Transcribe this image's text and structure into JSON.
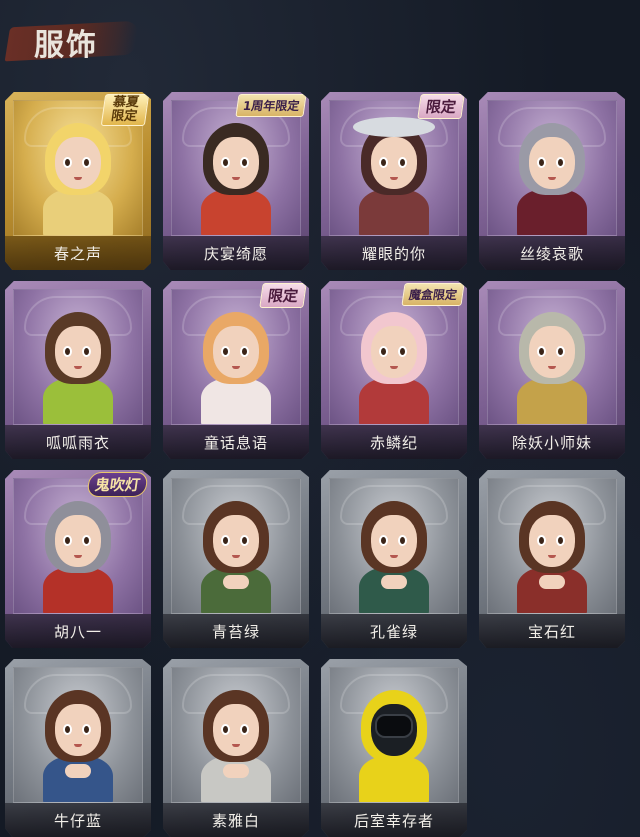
{
  "header": {
    "title": "服饰"
  },
  "costumes": [
    {
      "name": "春之声",
      "style": "gold",
      "badge": "慕夏限定",
      "badge_style": "gold-stamp",
      "hair": "#f2d46a",
      "outfit": "#e9cf7a"
    },
    {
      "name": "庆宴绮愿",
      "style": "purple",
      "badge": "1周年限定",
      "badge_style": "small",
      "hair": "#3a2a22",
      "outfit": "#c8432f"
    },
    {
      "name": "耀眼的你",
      "style": "purple",
      "badge": "限定",
      "badge_style": "pink",
      "hair": "#4a2a28",
      "outfit": "#7b3a3a",
      "hat": "#d7dbe0"
    },
    {
      "name": "丝绫哀歌",
      "style": "purple",
      "badge": "",
      "hair": "#9a9aa6",
      "outfit": "#6a1f2c"
    },
    {
      "name": "呱呱雨衣",
      "style": "purple",
      "badge": "",
      "hair": "#5a3a26",
      "outfit": "#9bbf3a"
    },
    {
      "name": "童话息语",
      "style": "purple",
      "badge": "限定",
      "badge_style": "pink",
      "hair": "#e9a866",
      "outfit": "#f0e6e4"
    },
    {
      "name": "赤鳞纪",
      "style": "purple",
      "badge": "魔盒限定",
      "badge_style": "small",
      "hair": "#f2c7cf",
      "outfit": "#b23a3a"
    },
    {
      "name": "除妖小师妹",
      "style": "purple",
      "badge": "",
      "hair": "#b8b8aa",
      "outfit": "#c4a24a"
    },
    {
      "name": "胡八一",
      "style": "purple",
      "badge": "鬼吹灯",
      "badge_style": "round",
      "hair": "#8f8f9a",
      "outfit": "#b43128"
    },
    {
      "name": "青苔绿",
      "style": "gray",
      "badge": "",
      "hair": "#5a3524",
      "outfit": "#4b6b3a"
    },
    {
      "name": "孔雀绿",
      "style": "gray",
      "badge": "",
      "hair": "#5a3524",
      "outfit": "#2f5a4a"
    },
    {
      "name": "宝石红",
      "style": "gray",
      "badge": "",
      "hair": "#5a3524",
      "outfit": "#8a2f2a"
    },
    {
      "name": "牛仔蓝",
      "style": "gray",
      "badge": "",
      "hair": "#5a3524",
      "outfit": "#35558a"
    },
    {
      "name": "素雅白",
      "style": "gray",
      "badge": "",
      "hair": "#5a3524",
      "outfit": "#c8c8c4"
    },
    {
      "name": "后室幸存者",
      "style": "gray",
      "badge": "",
      "hair": "#e8d21a",
      "outfit": "#e8d21a",
      "mask": true
    }
  ]
}
